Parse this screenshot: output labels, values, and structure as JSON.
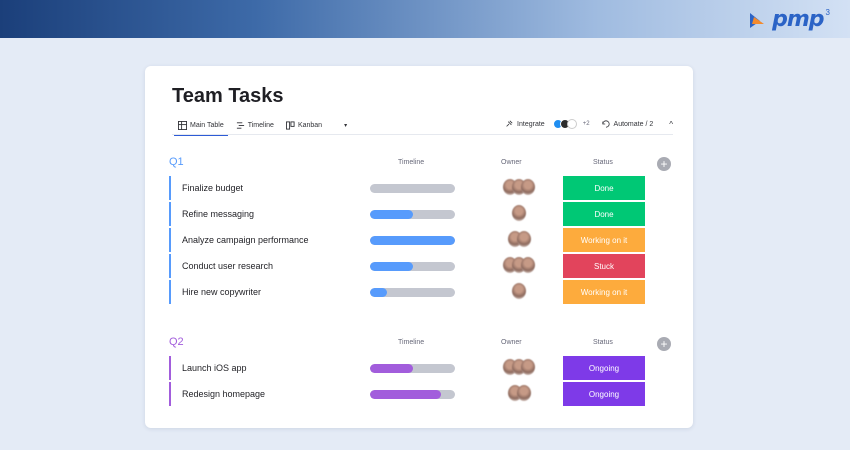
{
  "brand": {
    "logo_text": "pmp",
    "logo_sup": "3"
  },
  "board": {
    "title": "Team Tasks",
    "tabs": [
      {
        "label": "Main Table",
        "icon": "table-icon",
        "active": true
      },
      {
        "label": "Timeline",
        "icon": "timeline-icon",
        "active": false
      },
      {
        "label": "Kanban",
        "icon": "kanban-icon",
        "active": false
      }
    ],
    "tab_more": "▾",
    "toolbar": {
      "integrate_label": "Integrate",
      "integrate_extra": "+2",
      "automate_label": "Automate / 2",
      "collapse_glyph": "^"
    }
  },
  "colors": {
    "done": "#00c875",
    "working": "#fdab3d",
    "stuck": "#e2445c",
    "ongoing": "#7e3ae8",
    "q1_accent": "#579bfc",
    "q2_accent": "#a25ddc",
    "timeline_q1": "#579bfc",
    "timeline_q2": "#a25ddc"
  },
  "groups": [
    {
      "label": "Q1",
      "columns": {
        "timeline": "Timeline",
        "owner": "Owner",
        "status": "Status"
      },
      "add_label": "+",
      "tasks": [
        {
          "name": "Finalize budget",
          "progress": 0.0,
          "owners": 3,
          "status": "Done",
          "status_key": "done"
        },
        {
          "name": "Refine messaging",
          "progress": 0.5,
          "owners": 1,
          "status": "Done",
          "status_key": "done"
        },
        {
          "name": "Analyze campaign performance",
          "progress": 1.0,
          "owners": 2,
          "status": "Working on it",
          "status_key": "working"
        },
        {
          "name": "Conduct user research",
          "progress": 0.5,
          "owners": 3,
          "status": "Stuck",
          "status_key": "stuck"
        },
        {
          "name": "Hire new copywriter",
          "progress": 0.2,
          "owners": 1,
          "status": "Working on it",
          "status_key": "working"
        }
      ]
    },
    {
      "label": "Q2",
      "columns": {
        "timeline": "Timeline",
        "owner": "Owner",
        "status": "Status"
      },
      "add_label": "+",
      "tasks": [
        {
          "name": "Launch iOS app",
          "progress": 0.5,
          "owners": 3,
          "status": "Ongoing",
          "status_key": "ongoing"
        },
        {
          "name": "Redesign homepage",
          "progress": 0.83,
          "owners": 2,
          "status": "Ongoing",
          "status_key": "ongoing"
        }
      ]
    }
  ]
}
